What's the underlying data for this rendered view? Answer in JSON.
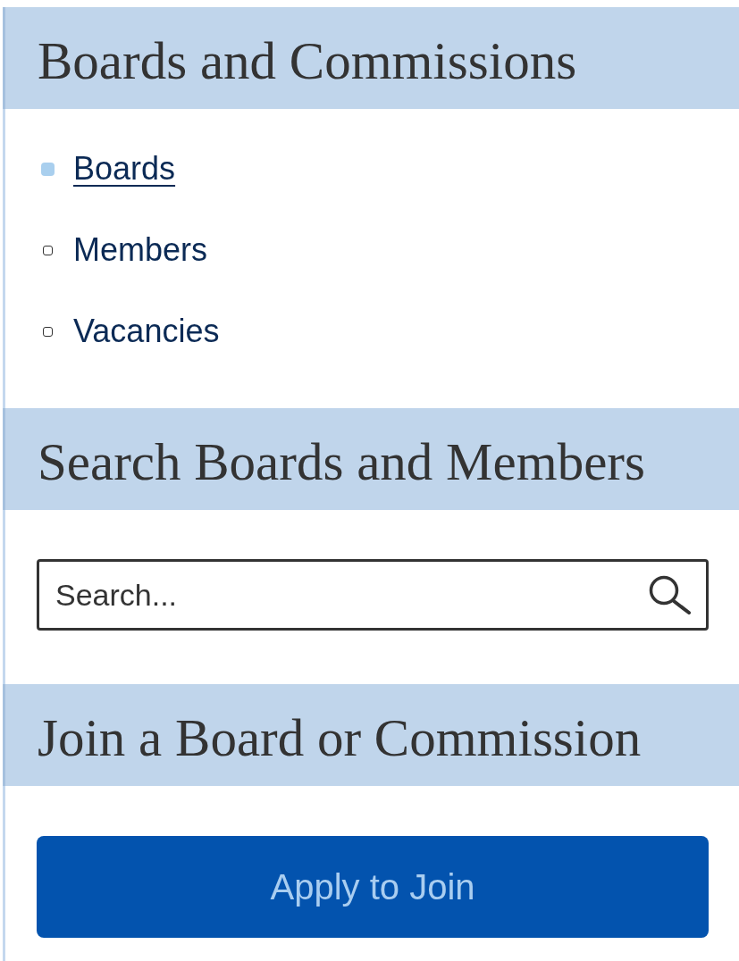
{
  "sections": [
    {
      "kind": "nav",
      "title": "Boards and Commissions",
      "items": [
        {
          "label": "Boards",
          "selected": true
        },
        {
          "label": "Members",
          "selected": false
        },
        {
          "label": "Vacancies",
          "selected": false
        }
      ]
    },
    {
      "kind": "search",
      "title": "Search Boards and Members",
      "search": {
        "placeholder": "Search..."
      }
    },
    {
      "kind": "action",
      "title": "Join a Board or Commission",
      "button": "Apply to Join"
    }
  ]
}
